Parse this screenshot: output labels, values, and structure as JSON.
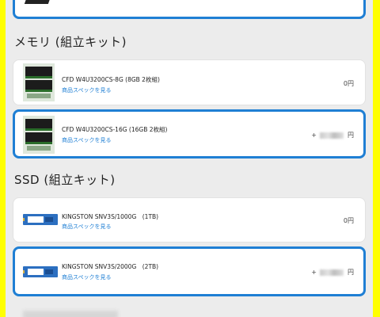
{
  "sections": [
    {
      "title": "メモリ (組立キット)"
    },
    {
      "title": "SSD (組立キット)"
    }
  ],
  "memory_items": [
    {
      "name": "CFD W4U3200CS-8G (8GB 2枚組)",
      "spec_link": "商品スペックを見る",
      "price_prefix": "",
      "price_suffix": "0円",
      "selected": false
    },
    {
      "name": "CFD W4U3200CS-16G (16GB 2枚組)",
      "spec_link": "商品スペックを見る",
      "price_prefix": "+",
      "price_suffix": "円",
      "selected": true
    }
  ],
  "ssd_items": [
    {
      "name": "KINGSTON SNV3S/1000G　(1TB)",
      "spec_link": "商品スペックを見る",
      "price_prefix": "",
      "price_suffix": "0円",
      "selected": false
    },
    {
      "name": "KINGSTON SNV3S/2000G　(2TB)",
      "spec_link": "商品スペックを見る",
      "price_prefix": "+",
      "price_suffix": "円",
      "selected": true
    }
  ],
  "colors": {
    "accent": "#1f7fd4",
    "highlight_border": "#ffff00",
    "background": "#ececec"
  },
  "icons": {
    "memory": "ram-module-icon",
    "ssd": "m2-ssd-icon"
  }
}
